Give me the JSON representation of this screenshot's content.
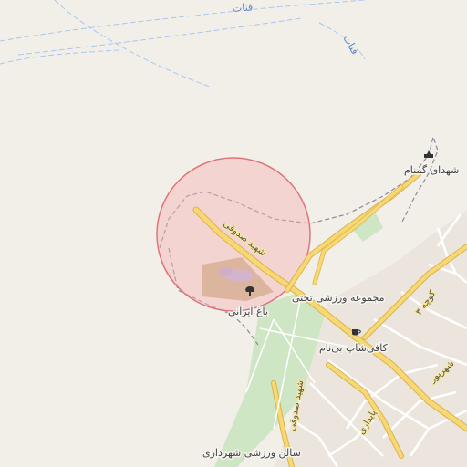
{
  "map": {
    "colors": {
      "background": "#f2efe9",
      "water_line": "#a9c7f0",
      "major_road": "#f7d875",
      "major_road_casing": "#d9b44a",
      "minor_road": "#ffffff",
      "park": "#cfe6c4",
      "garden": "#c9b78f",
      "search_circle_fill": "#f4b3b3",
      "search_circle_stroke": "#e0747a",
      "boundary": "#8a8a9a"
    },
    "water_labels": {
      "qanat_1": "قنات",
      "qanat_2": "قنات"
    },
    "streets": {
      "shahid_sadoughi_1": "شهید صدوقی",
      "shahid_sadoughi_2": "شهید صدوقی",
      "sevom": "کوچه ۳",
      "shahrivar": "شهریور",
      "paydari": "پایداری"
    },
    "places": {
      "shohada_gomnam": "شهدای گمنام",
      "sports_complex": "مجموعه ورزشی تختی",
      "coffee_shop": "کافی‌شاپ بی‌نام",
      "bagh_irani": "باغ ایرانی",
      "sports_hall": "سالن ورزشی شهرداری"
    },
    "icons": {
      "memorial": "memorial-icon",
      "cafe": "cafe-icon",
      "garden": "tree-icon"
    }
  }
}
